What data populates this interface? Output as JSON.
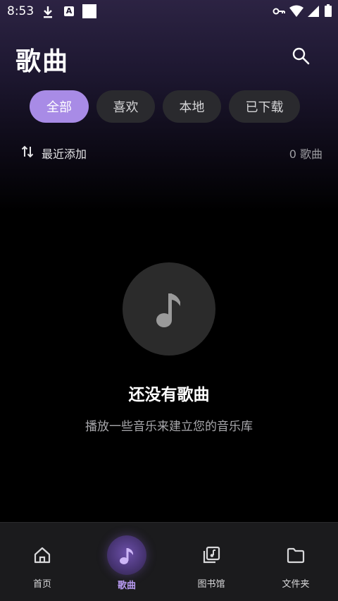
{
  "status_bar": {
    "time": "8:53",
    "icons": [
      "download-icon",
      "a-badge-icon",
      "square-icon",
      "vpn-key-icon",
      "wifi-icon",
      "signal-icon",
      "battery-icon"
    ],
    "a_badge_text": "A"
  },
  "header": {
    "title": "歌曲",
    "search_icon": "search-icon"
  },
  "filters": {
    "chips": [
      {
        "label": "全部",
        "active": true
      },
      {
        "label": "喜欢",
        "active": false
      },
      {
        "label": "本地",
        "active": false
      },
      {
        "label": "已下载",
        "active": false
      }
    ]
  },
  "sort": {
    "icon": "sort-arrows-icon",
    "label": "最近添加",
    "count": "0 歌曲"
  },
  "empty_state": {
    "icon": "music-note-icon",
    "title": "还没有歌曲",
    "subtitle": "播放一些音乐来建立您的音乐库"
  },
  "bottom_nav": {
    "items": [
      {
        "label": "首页",
        "icon": "home-icon",
        "active": false
      },
      {
        "label": "歌曲",
        "icon": "music-note-icon",
        "active": true
      },
      {
        "label": "图书馆",
        "icon": "library-icon",
        "active": false
      },
      {
        "label": "文件夹",
        "icon": "folder-icon",
        "active": false
      }
    ]
  },
  "colors": {
    "accent": "#a88be6",
    "active_nav": "#b79af0",
    "chip_bg": "#2a2a2e",
    "header_gradient_top": "#2c2343",
    "background": "#000000"
  }
}
